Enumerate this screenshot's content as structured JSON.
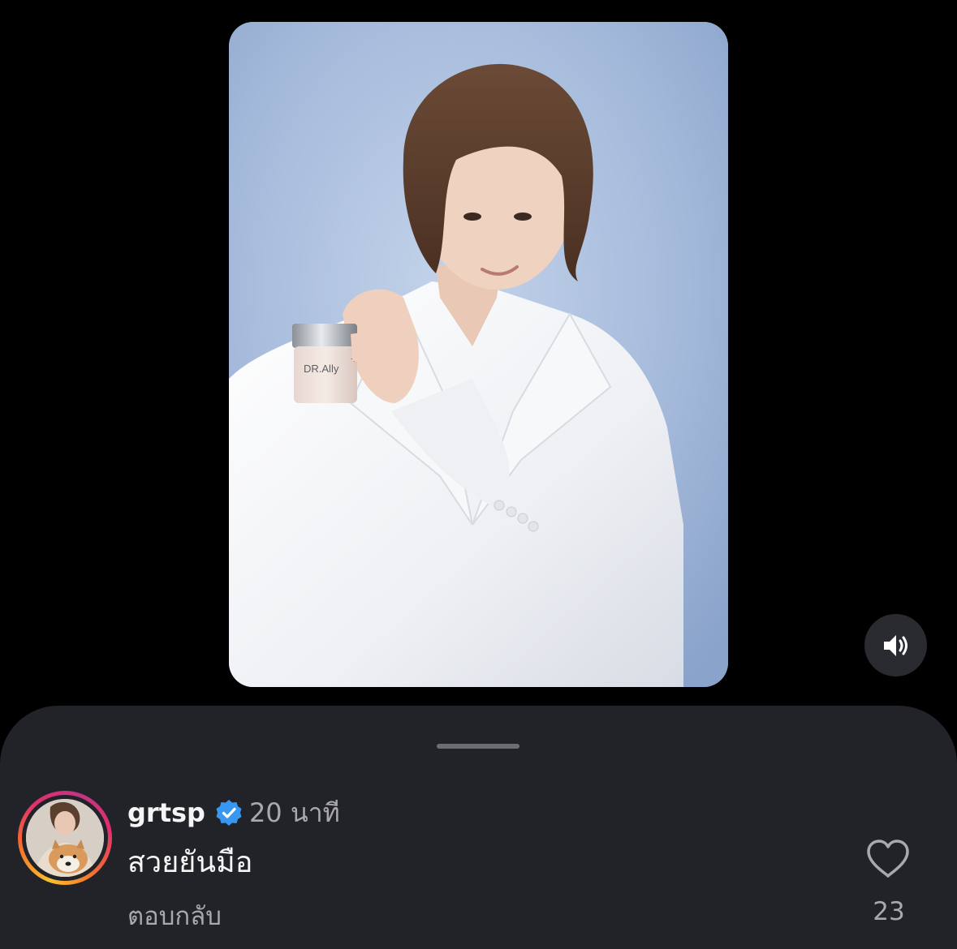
{
  "media": {
    "product_label": "DR.Ally",
    "sound_icon": "speaker-volume-icon"
  },
  "comment": {
    "username": "grtsp",
    "verified_icon": "verified-badge-icon",
    "timestamp": "20 นาที",
    "text": "สวยยันมือ",
    "reply_label": "ตอบกลับ",
    "like_icon": "heart-outline-icon",
    "like_count": "23"
  },
  "colors": {
    "background": "#000000",
    "sheet": "#212329",
    "verified_blue": "#3897f0",
    "secondary_text": "#a8a8ad",
    "primary_text": "#f5f5f5"
  }
}
